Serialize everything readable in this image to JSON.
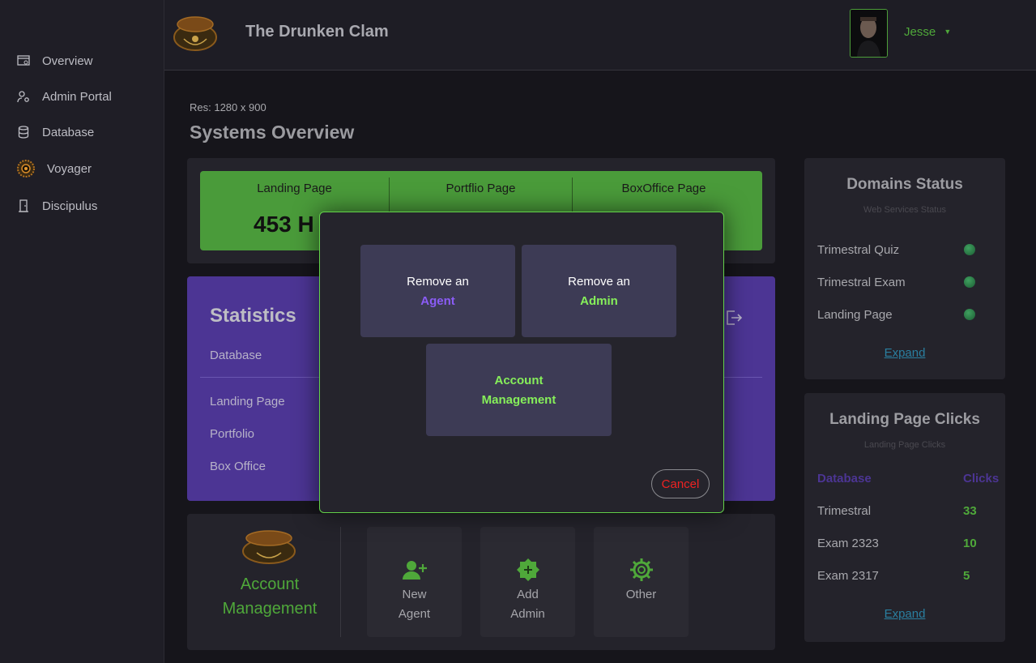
{
  "sidebar": {
    "items": [
      {
        "label": "Overview",
        "icon": "overview-icon"
      },
      {
        "label": "Admin Portal",
        "icon": "admin-icon"
      },
      {
        "label": "Database",
        "icon": "database-icon"
      },
      {
        "label": "Voyager",
        "icon": "voyager-icon"
      },
      {
        "label": "Discipulus",
        "icon": "door-icon"
      }
    ]
  },
  "header": {
    "brand": "The Drunken Clam",
    "user": "Jesse",
    "logo_text": "The Drunken Clam"
  },
  "page": {
    "res": "Res: 1280 x 900",
    "title": "Systems Overview"
  },
  "green_bar": {
    "columns": [
      "Landing Page",
      "Portflio Page",
      "BoxOffice Page"
    ],
    "value": "453 H"
  },
  "statistics": {
    "title": "Statistics",
    "rows": [
      "Database",
      "Landing Page",
      "Portfolio",
      "Box Office"
    ]
  },
  "modal": {
    "remove_agent_prefix": "Remove an",
    "remove_agent_highlight": "Agent",
    "remove_admin_prefix": "Remove an",
    "remove_admin_highlight": "Admin",
    "account_line1": "Account",
    "account_line2": "Management",
    "cancel": "Cancel"
  },
  "account_card": {
    "title_line1": "Account",
    "title_line2": "Management",
    "tiles": [
      {
        "line1": "New",
        "line2": "Agent",
        "icon": "add-user-icon"
      },
      {
        "line1": "Add",
        "line2": "Admin",
        "icon": "add-admin-icon"
      },
      {
        "line1": "Other",
        "line2": "",
        "icon": "gear-icon"
      }
    ]
  },
  "domains": {
    "title": "Domains Status",
    "subtitle": "Web Services Status",
    "items": [
      "Trimestral Quiz",
      "Trimestral Exam",
      "Landing Page"
    ],
    "status_color": "#2e8b4e",
    "link": "Expand"
  },
  "clicks": {
    "title": "Landing Page Clicks",
    "subtitle": "Landing Page Clicks",
    "header_db": "Database",
    "header_clicks": "Clicks",
    "rows": [
      {
        "name": "Trimestral",
        "clicks": "33"
      },
      {
        "name": "Exam 2323",
        "clicks": "10"
      },
      {
        "name": "Exam 2317",
        "clicks": "5"
      }
    ],
    "link": "Expand"
  },
  "colors": {
    "accent_green": "#4fa83a",
    "accent_purple": "#4c3594",
    "modal_border": "#63d24a"
  }
}
